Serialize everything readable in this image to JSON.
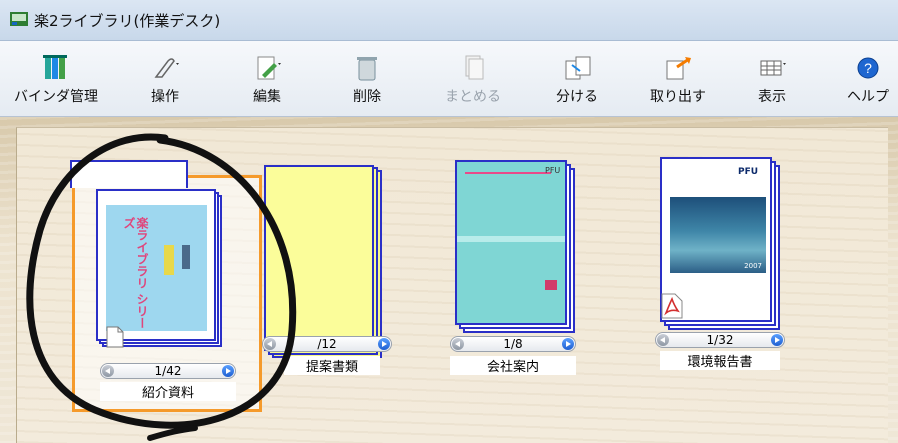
{
  "window": {
    "title": "楽2ライブラリ(作業デスク)"
  },
  "toolbar": {
    "binder_manage": "バインダ管理",
    "operation": "操作",
    "edit": "編集",
    "delete": "削除",
    "combine": "まとめる",
    "split": "分ける",
    "extract": "取り出す",
    "view": "表示",
    "help": "ヘルプ"
  },
  "binders": [
    {
      "name": "紹介資料",
      "pager": "1/42"
    },
    {
      "name": "提案書類",
      "pager": "/12"
    },
    {
      "name": "会社案内",
      "pager": "1/8"
    },
    {
      "name": "環境報告書",
      "pager": "1/32"
    }
  ],
  "doc_texts": {
    "intro_vertical": "楽ライブラリ シリーズ",
    "brand": "PFU",
    "year": "2007"
  }
}
